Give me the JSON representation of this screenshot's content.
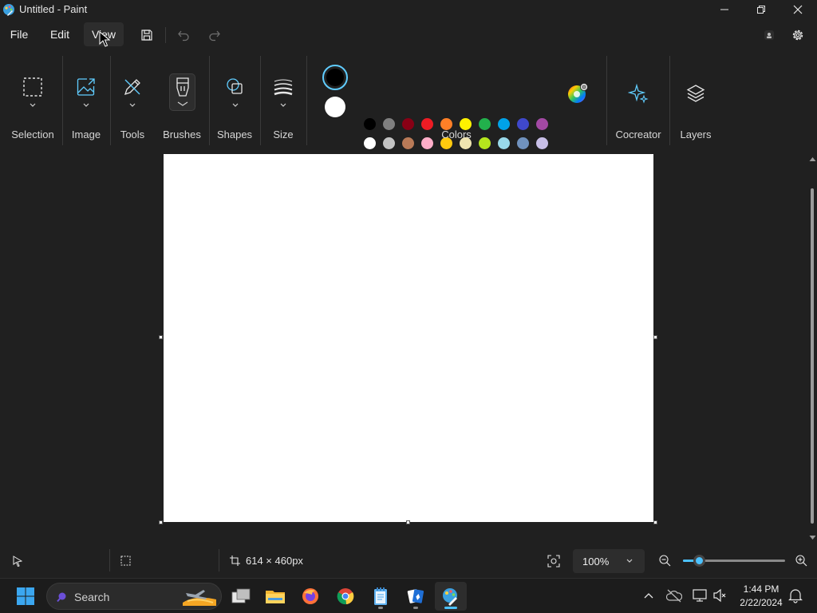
{
  "window": {
    "title": "Untitled - Paint"
  },
  "menu": {
    "file": "File",
    "edit": "Edit",
    "view": "View"
  },
  "ribbon": {
    "groups": {
      "selection": "Selection",
      "image": "Image",
      "tools": "Tools",
      "brushes": "Brushes",
      "shapes": "Shapes",
      "size": "Size",
      "colors": "Colors",
      "cocreator": "Cocreator",
      "layers": "Layers"
    },
    "active_colors": {
      "primary": "#000000",
      "secondary": "#ffffff"
    },
    "palette_row1": [
      "#000000",
      "#7f7f7f",
      "#880015",
      "#ed1c24",
      "#ff7f27",
      "#fff200",
      "#22b14c",
      "#00a2e8",
      "#3f48cc",
      "#a349a4"
    ],
    "palette_row2": [
      "#ffffff",
      "#c3c3c3",
      "#b97a57",
      "#ffaec9",
      "#ffc90e",
      "#efe4b0",
      "#b5e61d",
      "#99d9ea",
      "#7092be",
      "#c8bfe7"
    ],
    "palette_row3_empty_count": 10
  },
  "status": {
    "canvas_size": "614 × 460px",
    "zoom": "100%"
  },
  "taskbar": {
    "search_placeholder": "Search",
    "time": "1:44 PM",
    "date": "2/22/2024"
  },
  "colors": {
    "accent": "#4cc2ff",
    "background": "#202020"
  }
}
